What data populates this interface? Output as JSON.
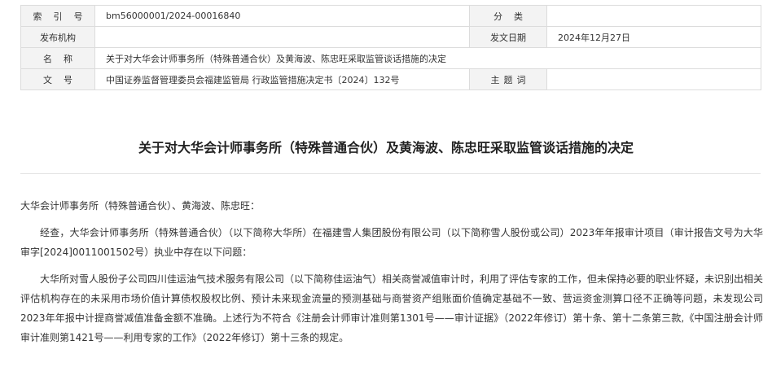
{
  "meta": {
    "index_label": "索引号",
    "index_value": "bm56000001/2024-00016840",
    "category_label": "分类",
    "category_value": "",
    "issuer_label": "发布机构",
    "issuer_value": "",
    "date_label": "发文日期",
    "date_value": "2024年12月27日",
    "name_label": "名称",
    "name_value": "关于对大华会计师事务所（特殊普通合伙）及黄海波、陈忠旺采取监管谈话措施的决定",
    "docno_label": "文号",
    "docno_value": "中国证券监督管理委员会福建监管局 行政监管措施决定书〔2024〕132号",
    "subject_label": "主题词",
    "subject_value": ""
  },
  "document": {
    "title": "关于对大华会计师事务所（特殊普通合伙）及黄海波、陈忠旺采取监管谈话措施的决定",
    "salutation": "大华会计师事务所（特殊普通合伙）、黄海波、陈忠旺：",
    "paragraphs": [
      "经查，大华会计师事务所（特殊普通合伙）（以下简称大华所）在福建雪人集团股份有限公司（以下简称雪人股份或公司）2023年年报审计项目（审计报告文号为大华审字[2024]0011001502号）执业中存在以下问题：",
      "大华所对雪人股份子公司四川佳运油气技术服务有限公司（以下简称佳运油气）相关商誉减值审计时，利用了评估专家的工作，但未保持必要的职业怀疑，未识别出相关评估机构存在的未采用市场价值计算债权股权比例、预计未来现金流量的预测基础与商誉资产组账面价值确定基础不一致、营运资金测算口径不正确等问题，未发现公司2023年年报中计提商誉减值准备金额不准确。上述行为不符合《注册会计师审计准则第1301号——审计证据》（2022年修订）第十条、第十二条第三款,《中国注册会计师审计准则第1421号——利用专家的工作》（2022年修订）第十三条的规定。"
    ]
  }
}
